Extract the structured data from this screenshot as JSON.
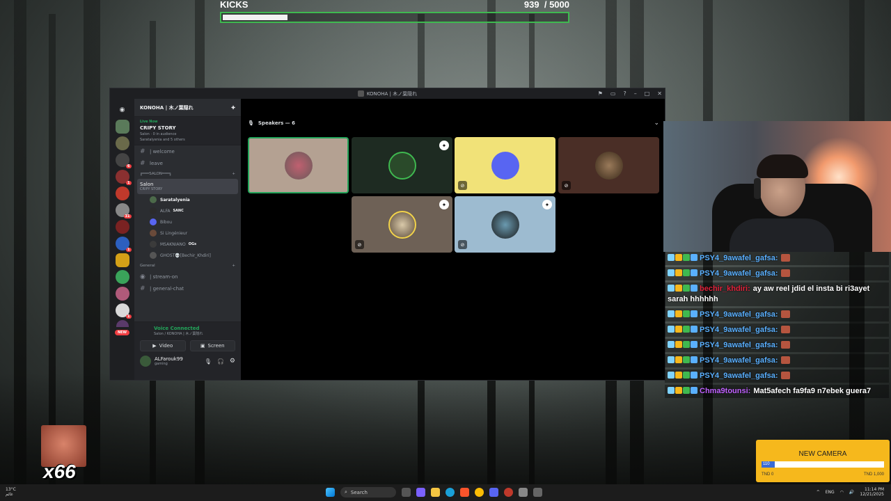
{
  "kicks": {
    "label": "KICKS",
    "current": "939",
    "goal": "/ 5000",
    "progress": 0.188
  },
  "discord": {
    "window_title": "KONOHA | 木ノ葉隠れ",
    "server_name": "KONOHA | 木ノ葉隠れ",
    "live": {
      "badge": "Live Now",
      "title": "CRIPY STORY",
      "sub1": "Salon · 0 in audience",
      "sub2": "Saratalyenia and 5 others"
    },
    "channels": [
      {
        "icon": "#",
        "name": "| welcome"
      },
      {
        "icon": "#",
        "name": "leave"
      }
    ],
    "category_salon": "╔═══SALON═══╗",
    "active_channel": {
      "name": "Salon",
      "sub": "CRIPY STORY"
    },
    "members": [
      {
        "name": "Saratalyenia",
        "tag": "",
        "bold": true,
        "color": "#4c6a4a"
      },
      {
        "name": "ALFA",
        "tag": "SANC",
        "bold": false,
        "color": "#2b2b2b"
      },
      {
        "name": "Bibou",
        "tag": "",
        "bold": false,
        "color": "#5865f2"
      },
      {
        "name": "Si Lingénieur",
        "tag": "",
        "bold": false,
        "color": "#6a4a3a"
      },
      {
        "name": "MSAKNIANO",
        "tag": "OGs",
        "bold": false,
        "color": "#3b3b3b"
      },
      {
        "name": "GHOST💀[Bechir_Khdiri]",
        "tag": "",
        "bold": false,
        "color": "#555"
      }
    ],
    "category_general": "General",
    "general_channels": [
      {
        "icon": "◉",
        "name": "| stream-on"
      },
      {
        "icon": "#",
        "name": "| general-chat"
      }
    ],
    "voice": {
      "status": "Voice Connected",
      "sub": "Salon / KONOHA | 木ノ葉隠れ",
      "video": "Video",
      "screen": "Screen"
    },
    "user": {
      "name": "ALFarouk99",
      "status": "gaming"
    },
    "speakers_label": "Speakers — 6",
    "guild_new": "NEW"
  },
  "chat": [
    {
      "user": "PSY4_9awafel_gafsa:",
      "color": "#5ab0ff",
      "text": ""
    },
    {
      "user": "PSY4_9awafel_gafsa:",
      "color": "#5ab0ff",
      "text": ""
    },
    {
      "user": "bechir_khdiri:",
      "color": "#e0213a",
      "text": "ay aw reel jdid el insta bi ri3ayet sarah hhhhhh"
    },
    {
      "user": "PSY4_9awafel_gafsa:",
      "color": "#5ab0ff",
      "text": ""
    },
    {
      "user": "PSY4_9awafel_gafsa:",
      "color": "#5ab0ff",
      "text": ""
    },
    {
      "user": "PSY4_9awafel_gafsa:",
      "color": "#5ab0ff",
      "text": ""
    },
    {
      "user": "PSY4_9awafel_gafsa:",
      "color": "#5ab0ff",
      "text": ""
    },
    {
      "user": "PSY4_9awafel_gafsa:",
      "color": "#5ab0ff",
      "text": ""
    },
    {
      "user": "Chma9tounsi:",
      "color": "#c061ff",
      "text": "Mat5afech fa9fa9 n7ebek guera7"
    }
  ],
  "goal": {
    "title": "NEW CAMERA",
    "current": "110",
    "min": "TND 0",
    "max": "TND 1,000",
    "progress": 0.11
  },
  "emote_count": "x66",
  "taskbar": {
    "temp": "13°C",
    "weather": "غائم",
    "search": "Search",
    "lang": "ENG",
    "time": "11:14 PM",
    "date": "12/21/2025"
  }
}
